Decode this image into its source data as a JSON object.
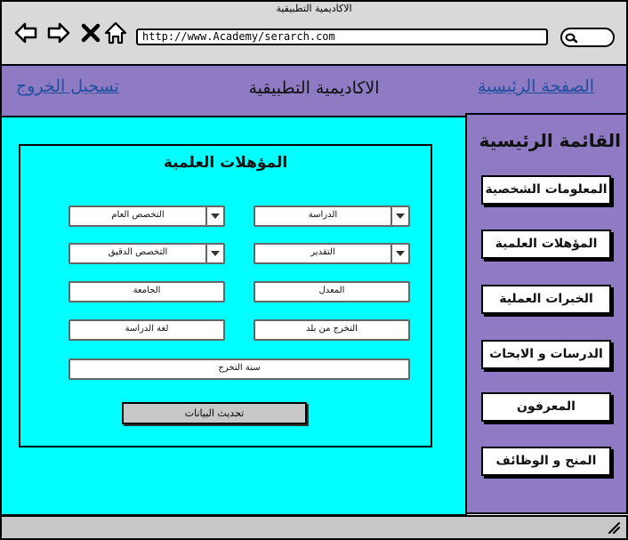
{
  "window": {
    "title": "الاكاديمية التطبيقية"
  },
  "browser": {
    "url": "http://www.Academy/serarch.com"
  },
  "header": {
    "logout": "تسجيل الخروج",
    "site_title": "الاكاديمية التطبيقية",
    "home": "الصفحة الرئيسية"
  },
  "form": {
    "title": "المؤهلات العلمية",
    "study": "الدراسة",
    "general_major": "التخصص العام",
    "grade": "التقدير",
    "specific_major": "التخصص الدقيق",
    "gpa": "المعدل",
    "university": "الجامعة",
    "graduation_country": "التخرج من بلد",
    "study_language": "لغة الدراسة",
    "graduation_year": "سنة التخرج",
    "update_button": "تحديث البيانات"
  },
  "sidebar": {
    "title": "القائمة الرئيسية",
    "items": [
      {
        "label": "المعلومات الشخصية"
      },
      {
        "label": "المؤهلات العلمية"
      },
      {
        "label": "الخبرات العملية"
      },
      {
        "label": "الدرسات و الابحاث"
      },
      {
        "label": "المعرفون"
      },
      {
        "label": "المنح و الوظائف"
      }
    ]
  },
  "colors": {
    "header_bg": "#8f7bc4",
    "main_bg": "#00ffff",
    "link": "#1f4f9e",
    "chrome_bg": "#d9d9d9"
  }
}
